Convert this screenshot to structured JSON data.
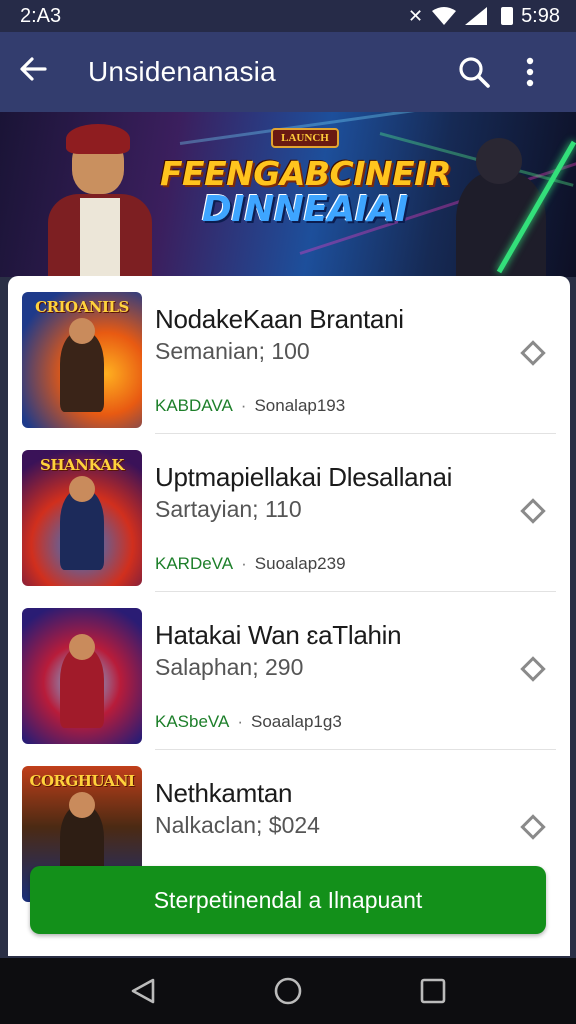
{
  "status_bar": {
    "time_left": "2:A3",
    "time_right": "5:98",
    "icons": [
      "mute-icon",
      "wifi-icon",
      "signal-icon",
      "battery-icon"
    ]
  },
  "app_bar": {
    "title": "Unsidenanasia",
    "back_icon": "arrow-back-icon",
    "search_icon": "search-icon",
    "more_icon": "more-vert-icon"
  },
  "banner": {
    "badge": "LAUNCH",
    "headline_line1": "FEENGABCINEIR",
    "headline_line2": "DINNEAIAI"
  },
  "list": [
    {
      "thumb_label": "CRIOANILS",
      "name": "NodakeKaan Brantani",
      "price": "Semanian; 100",
      "developer": "KABDAVA",
      "category": "Sonalap193",
      "colors": [
        "#1e3a8a",
        "#e85a12",
        "#ffb020"
      ]
    },
    {
      "thumb_label": "SHANKAK",
      "name": "Uptmapiellakai Dlesallanai",
      "price": "Sartayian; 110",
      "developer": "KARDeVA",
      "category": "Suoalap239",
      "colors": [
        "#3a1258",
        "#d12f1d",
        "#2a7bd8"
      ]
    },
    {
      "thumb_label": "",
      "name": "Hatakai Wan ɛaTlahin",
      "price": "Salaphan; 290",
      "developer": "KASbeVA",
      "category": "Soaalap1g3",
      "colors": [
        "#2a1c74",
        "#b81c3a",
        "#6fd0ff"
      ]
    },
    {
      "thumb_label": "CORGHUANI",
      "name": "Nethkamtan",
      "price": "Nalkaclan; $024",
      "developer": "",
      "category": "",
      "colors": [
        "#4b2a13",
        "#c13f1a",
        "#1a2f7a"
      ]
    }
  ],
  "cta": {
    "label": "Sterpetinendal a Ilnapuant"
  },
  "nav": {
    "back_icon": "nav-back-icon",
    "home_icon": "nav-home-icon",
    "recents_icon": "nav-recents-icon"
  }
}
